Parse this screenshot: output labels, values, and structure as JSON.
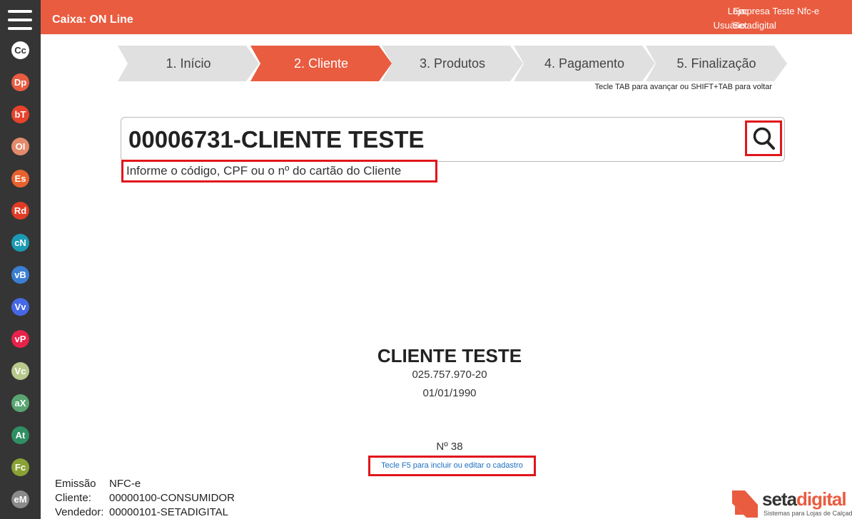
{
  "header": {
    "title": "Caixa: ON Line",
    "loja_label": "Loja:",
    "loja_value": "Empresa Teste Nfc-e",
    "usuario_label": "Usuário:",
    "usuario_value": "Setadigital"
  },
  "sidebar": {
    "items": [
      {
        "label": "Cc",
        "color": "#ffffff",
        "text_color": "#333333"
      },
      {
        "label": "Dp",
        "color": "#e95c40"
      },
      {
        "label": "bT",
        "color": "#e7432c"
      },
      {
        "label": "OI",
        "color": "#e38a6c"
      },
      {
        "label": "Es",
        "color": "#e8622e"
      },
      {
        "label": "Rd",
        "color": "#e03c25"
      },
      {
        "label": "cN",
        "color": "#1b9bb3"
      },
      {
        "label": "vB",
        "color": "#3b7ed2"
      },
      {
        "label": "Vv",
        "color": "#4668e6"
      },
      {
        "label": "vP",
        "color": "#e8224a"
      },
      {
        "label": "Vc",
        "color": "#b7c98d"
      },
      {
        "label": "aX",
        "color": "#59a572"
      },
      {
        "label": "At",
        "color": "#2f8f63"
      },
      {
        "label": "Fc",
        "color": "#8aa233"
      },
      {
        "label": "eM",
        "color": "#8a8a8a"
      }
    ]
  },
  "steps": [
    {
      "label": "1. Início",
      "active": false
    },
    {
      "label": "2. Cliente",
      "active": true
    },
    {
      "label": "3. Produtos",
      "active": false
    },
    {
      "label": "4. Pagamento",
      "active": false
    },
    {
      "label": "5. Finalização",
      "active": false
    }
  ],
  "steps_hint": "Tecle TAB para avançar ou SHIFT+TAB para voltar",
  "search": {
    "value": "00006731-CLIENTE TESTE",
    "hint": "Informe o código, CPF ou o nº do cartão do Cliente"
  },
  "client": {
    "name": "CLIENTE TESTE",
    "document": "025.757.970-20",
    "birth_date": "01/01/1990",
    "number": "Nº 38",
    "f5_hint": "Tecle F5 para incluir ou editar o cadastro"
  },
  "footer": {
    "emissao_label": "Emissão",
    "emissao_value": "NFC-e",
    "cliente_label": "Cliente:",
    "cliente_value": "00000100-CONSUMIDOR",
    "vendedor_label": "Vendedor:",
    "vendedor_value": "00000101-SETADIGITAL"
  },
  "logo": {
    "name_part1": "seta",
    "name_part2": "digital",
    "tagline": "Sistemas para Lojas de Calçados"
  },
  "colors": {
    "accent": "#e95c40",
    "sidebar_bg": "#353535",
    "step_inactive": "#e0e0e0",
    "highlight_border": "#e0161b",
    "link": "#1a6fc2"
  }
}
